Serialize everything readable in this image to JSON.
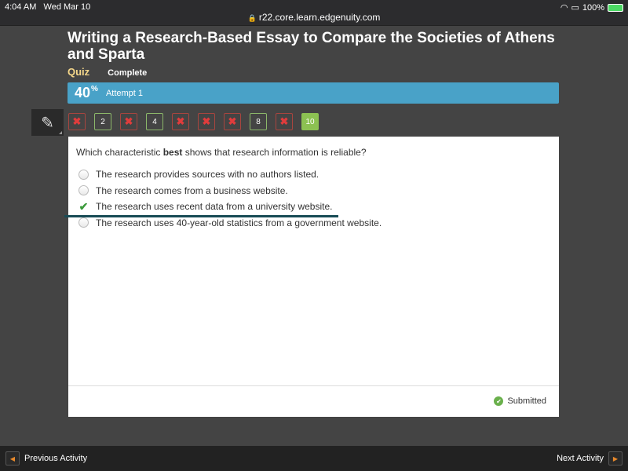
{
  "statusbar": {
    "time": "4:04 AM",
    "date": "Wed Mar 10",
    "url": "r22.core.learn.edgenuity.com",
    "battery": "100%"
  },
  "header": {
    "title": "Writing a Research-Based Essay to Compare the Societies of Athens and Sparta",
    "type": "Quiz",
    "status": "Complete"
  },
  "score": {
    "value": "40",
    "unit": "%",
    "attempt": "Attempt 1"
  },
  "question_nav": [
    {
      "label": "✖",
      "state": "wrong"
    },
    {
      "label": "2",
      "state": "right"
    },
    {
      "label": "✖",
      "state": "wrong"
    },
    {
      "label": "4",
      "state": "right"
    },
    {
      "label": "✖",
      "state": "wrong"
    },
    {
      "label": "✖",
      "state": "wrong"
    },
    {
      "label": "✖",
      "state": "wrong"
    },
    {
      "label": "8",
      "state": "right"
    },
    {
      "label": "✖",
      "state": "wrong"
    },
    {
      "label": "10",
      "state": "current"
    }
  ],
  "question": {
    "prefix": "Which characteristic ",
    "bold": "best",
    "suffix": " shows that research information is reliable?",
    "answers": [
      {
        "text": "The research provides sources with no authors listed.",
        "selected": false
      },
      {
        "text": "The research comes from a business website.",
        "selected": false
      },
      {
        "text": "The research uses recent data from a university website.",
        "selected": true
      },
      {
        "text": "The research uses 40-year-old statistics from a government website.",
        "selected": false
      }
    ]
  },
  "footer": {
    "status": "Submitted"
  },
  "bottom_nav": {
    "prev": "Previous Activity",
    "next": "Next Activity"
  }
}
